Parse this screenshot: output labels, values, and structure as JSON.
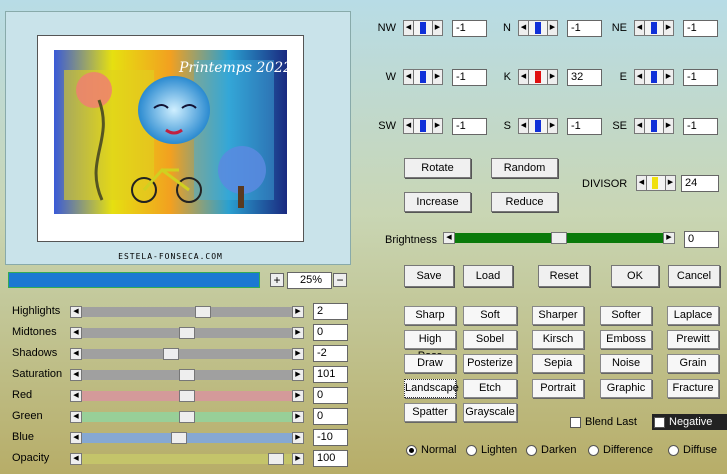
{
  "preview": {
    "title_text": "Printemps 2022",
    "caption": "ESTELA-FONSECA.COM"
  },
  "zoom": {
    "plus": "+",
    "minus": "−",
    "value": "25%"
  },
  "sliders": [
    {
      "label": "Highlights",
      "value": "2",
      "color": "#a0a0a0",
      "level": 0.58
    },
    {
      "label": "Midtones",
      "value": "0",
      "color": "#a0a0a0",
      "level": 0.5
    },
    {
      "label": "Shadows",
      "value": "-2",
      "color": "#a0a0a0",
      "level": 0.42
    },
    {
      "label": "Saturation",
      "value": "101",
      "color": "#a0a0a0",
      "level": 0.5
    },
    {
      "label": "Red",
      "value": "0",
      "color": "#d49a9a",
      "level": 0.5
    },
    {
      "label": "Green",
      "value": "0",
      "color": "#98cf98",
      "level": 0.5
    },
    {
      "label": "Blue",
      "value": "-10",
      "color": "#86a8d2",
      "level": 0.46
    },
    {
      "label": "Opacity",
      "value": "100",
      "color": "#c4c46a",
      "level": 0.96
    }
  ],
  "directions": [
    {
      "label": "NW",
      "value": "-1"
    },
    {
      "label": "N",
      "value": "-1"
    },
    {
      "label": "NE",
      "value": "-1"
    },
    {
      "label": "W",
      "value": "-1"
    },
    {
      "label": "K",
      "value": "32",
      "knob_color": "#e01010"
    },
    {
      "label": "E",
      "value": "-1"
    },
    {
      "label": "SW",
      "value": "-1"
    },
    {
      "label": "S",
      "value": "-1"
    },
    {
      "label": "SE",
      "value": "-1"
    }
  ],
  "actions": {
    "rotate": "Rotate",
    "random": "Random",
    "increase": "Increase",
    "reduce": "Reduce"
  },
  "divisor": {
    "label": "DIVISOR",
    "value": "24"
  },
  "brightness": {
    "label": "Brightness",
    "value": "0",
    "level": 0.5,
    "color": "#0a7a0a"
  },
  "dialog": {
    "save": "Save",
    "load": "Load",
    "reset": "Reset",
    "ok": "OK",
    "cancel": "Cancel"
  },
  "filters": [
    [
      "Sharp",
      "Soft",
      "Sharper",
      "Softer",
      "Laplace"
    ],
    [
      "High Pass",
      "Sobel",
      "Kirsch",
      "Emboss",
      "Prewitt"
    ],
    [
      "Draw",
      "Posterize",
      "Sepia",
      "Noise",
      "Grain"
    ],
    [
      "Landscape",
      "Etch",
      "Portrait",
      "Graphic",
      "Fracture"
    ],
    [
      "Spatter",
      "Grayscale"
    ]
  ],
  "selected_filter": "Landscape",
  "checkboxes": {
    "blend_last": "Blend Last",
    "negative": "Negative"
  },
  "blend_modes": [
    "Normal",
    "Lighten",
    "Darken",
    "Difference",
    "Diffuse"
  ],
  "selected_mode": "Normal"
}
